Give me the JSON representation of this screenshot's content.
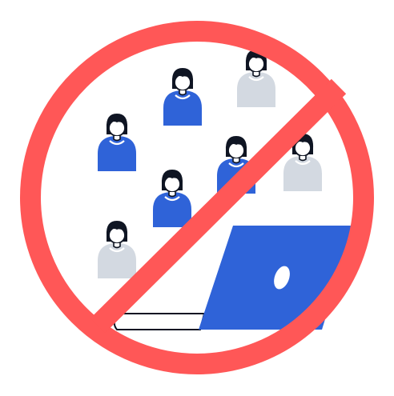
{
  "illustration": {
    "subject": "no-remote-meetings",
    "colors": {
      "prohibition": "#ff5757",
      "person_blue": "#2f63d8",
      "person_gray": "#d3d9e1",
      "hair": "#0f1523",
      "outline": "#0f1523",
      "laptop": "#2f63d8",
      "keyboard_base": "#ffffff",
      "background": "#ffffff"
    },
    "people": [
      {
        "shirt": "blue"
      },
      {
        "shirt": "gray"
      },
      {
        "shirt": "blue"
      },
      {
        "shirt": "blue"
      },
      {
        "shirt": "gray"
      },
      {
        "shirt": "blue"
      },
      {
        "shirt": "gray"
      }
    ]
  }
}
